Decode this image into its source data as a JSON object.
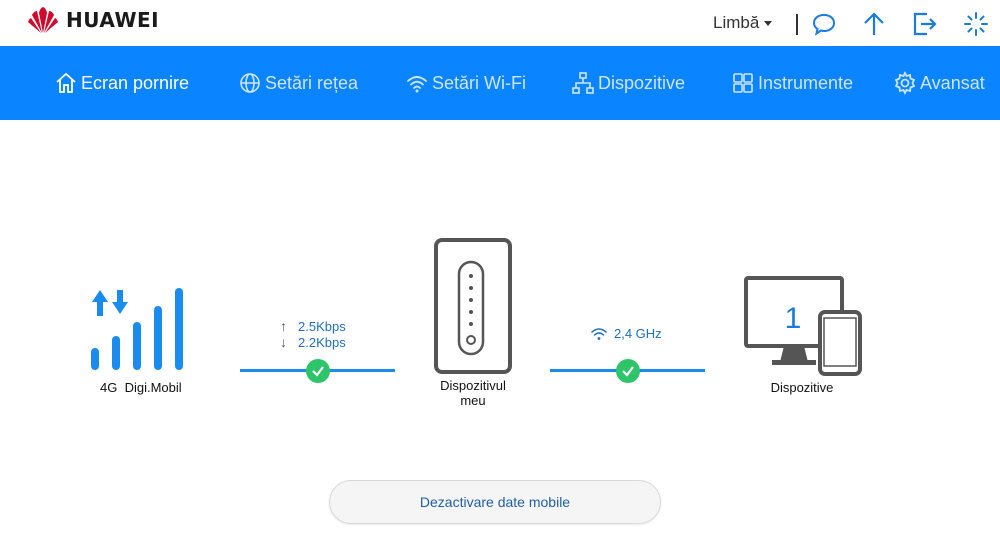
{
  "brand": {
    "name": "HUAWEI",
    "logo_color": "#cf0a2c"
  },
  "header": {
    "language_label": "Limbă",
    "icons": [
      "chat-icon",
      "upload-arrow-icon",
      "logout-icon",
      "loading-spinner-icon"
    ]
  },
  "nav": {
    "items": [
      {
        "label": "Ecran pornire",
        "icon": "home-icon",
        "active": true
      },
      {
        "label": "Setări rețea",
        "icon": "globe-icon",
        "active": false
      },
      {
        "label": "Setări Wi-Fi",
        "icon": "wifi-icon",
        "active": false
      },
      {
        "label": "Dispozitive",
        "icon": "network-icon",
        "active": false
      },
      {
        "label": "Instrumente",
        "icon": "tools-grid-icon",
        "active": false
      },
      {
        "label": "Avansat",
        "icon": "gear-icon",
        "active": false
      }
    ]
  },
  "status": {
    "network_type": "4G",
    "operator": "Digi.Mobil",
    "upload_speed": "2.5Kbps",
    "download_speed": "2.2Kbps",
    "router_label_line1": "Dispozitivul",
    "router_label_line2": "meu",
    "wifi_band": "2,4 GHz",
    "connected_devices_count": "1",
    "devices_label": "Dispozitive"
  },
  "actions": {
    "mobile_data_button": "Dezactivare date mobile"
  },
  "colors": {
    "nav_bg": "#0a84ff",
    "accent": "#1a8cf0",
    "ok": "#2ec56a"
  }
}
